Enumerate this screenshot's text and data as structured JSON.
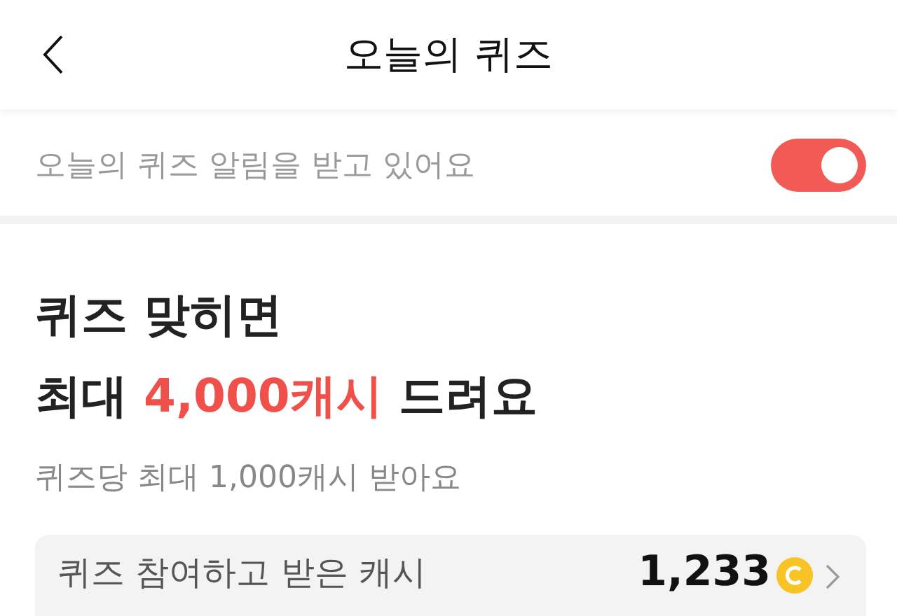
{
  "header": {
    "title": "오늘의 퀴즈"
  },
  "notification": {
    "label": "오늘의 퀴즈 알림을 받고 있어요",
    "on": true
  },
  "hero": {
    "line_1": "퀴즈 맞히면",
    "line_2": [
      {
        "text": "최대 ",
        "highlight": false
      },
      {
        "text": "4,000캐시",
        "highlight": true
      },
      {
        "text": " 드려요",
        "highlight": false
      }
    ],
    "subtitle": "퀴즈당 최대 1,000캐시 받아요"
  },
  "earned_card": {
    "label": "퀴즈 참여하고 받은 캐시",
    "amount": "1,233"
  }
}
